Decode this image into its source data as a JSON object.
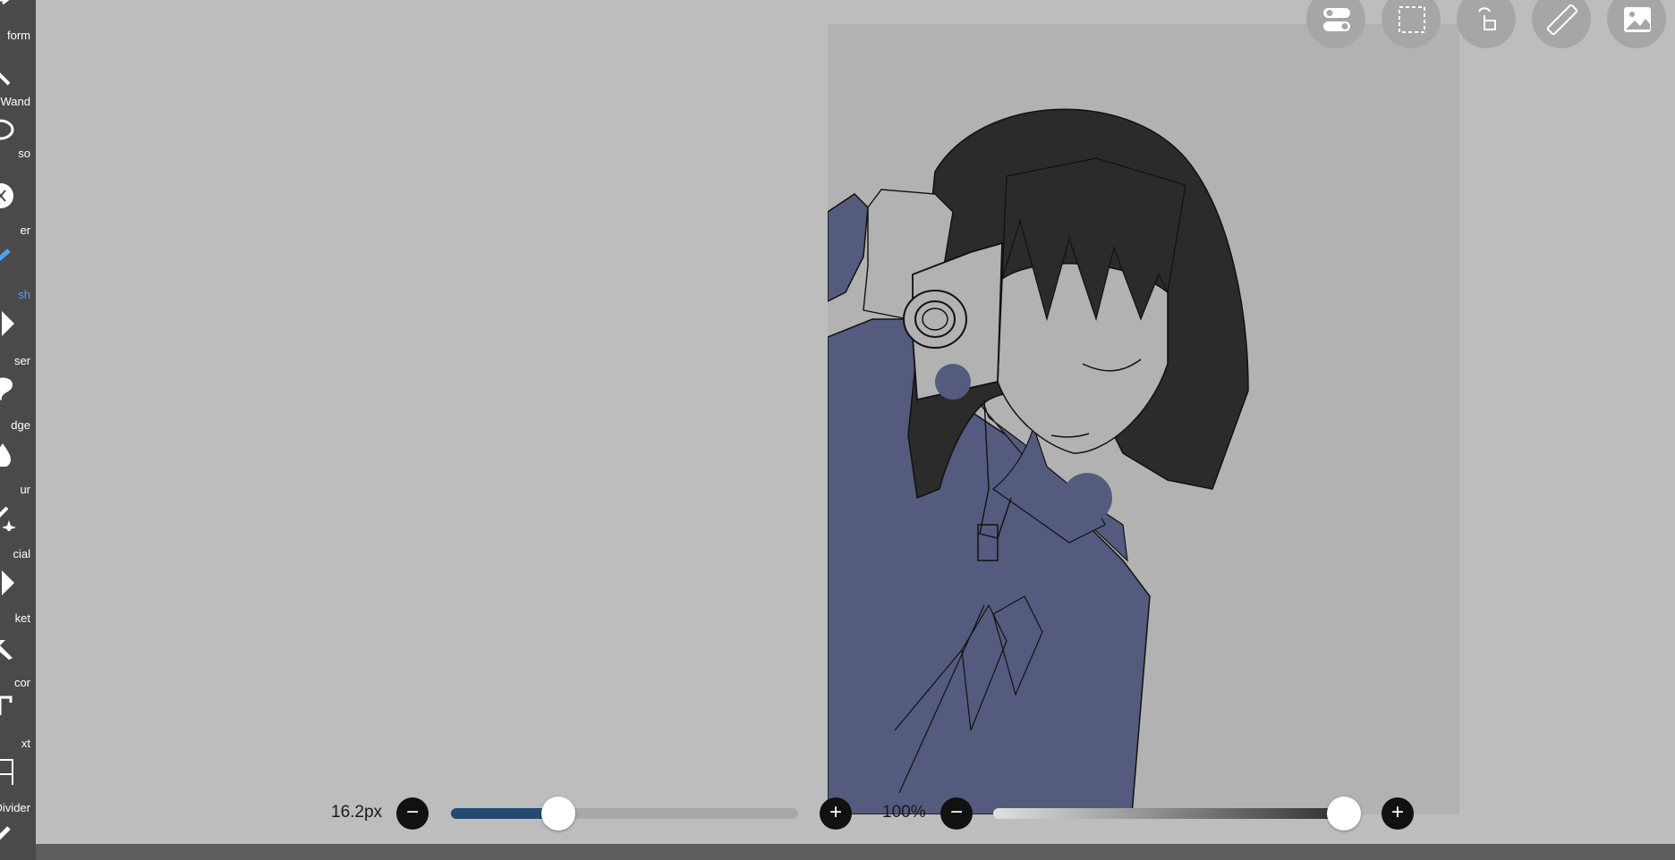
{
  "toolbar": {
    "tools": [
      {
        "label": "form",
        "icon": "transform-icon"
      },
      {
        "label": "Wand",
        "icon": "magic-wand-icon"
      },
      {
        "label": "so",
        "icon": "lasso-icon"
      },
      {
        "label": "er",
        "icon": "filter-icon"
      },
      {
        "label": "sh",
        "icon": "brush-icon",
        "active": true
      },
      {
        "label": "ser",
        "icon": "eraser-icon"
      },
      {
        "label": "dge",
        "icon": "smudge-icon"
      },
      {
        "label": "ur",
        "icon": "blur-icon"
      },
      {
        "label": "cial",
        "icon": "special-icon"
      },
      {
        "label": "ket",
        "icon": "bucket-icon"
      },
      {
        "label": "cor",
        "icon": "color-picker-icon"
      },
      {
        "label": "xt",
        "icon": "text-icon"
      },
      {
        "label": "Divider",
        "icon": "frame-divider-icon"
      }
    ]
  },
  "top_actions": [
    {
      "icon": "toggle-icon"
    },
    {
      "icon": "selection-icon"
    },
    {
      "icon": "touch-icon"
    },
    {
      "icon": "ruler-icon"
    },
    {
      "icon": "image-icon"
    }
  ],
  "brush": {
    "size_label": "16.2px",
    "size_fraction": 0.31,
    "opacity_label": "100%",
    "opacity_fraction": 1.0
  },
  "colors": {
    "accent": "#4aa3f0",
    "toolbar_bg": "#4a4a4a",
    "canvas_bg": "#bdbdbd",
    "paper": "#b2b2b2",
    "hair": "#2b2b2b",
    "uniform": "#555b7e",
    "slider_fill": "#244a72"
  }
}
